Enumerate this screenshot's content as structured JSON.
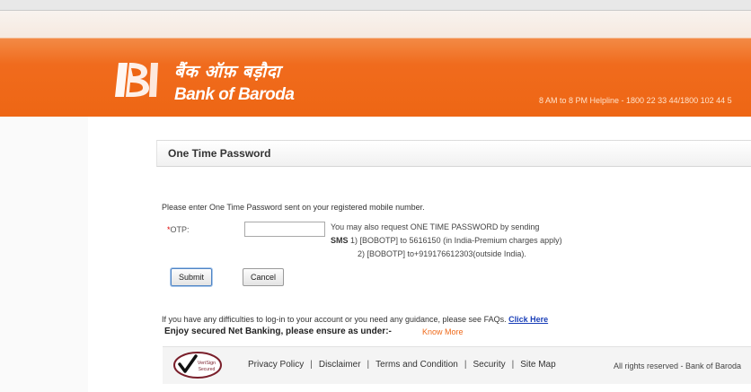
{
  "header": {
    "logo_hindi": "बैंक ऑफ़ बड़ौदा",
    "logo_english": "Bank of Baroda",
    "helpline": "8 AM to 8 PM Helpline - 1800 22 33 44/1800 102 44 5"
  },
  "otp_section": {
    "title": "One Time Password",
    "instruction": "Please enter One Time Password sent on your registered mobile number.",
    "otp_label_required": "*",
    "otp_label": "OTP:",
    "otp_value": "",
    "sms_line1": "You may also request ONE TIME PASSWORD by sending",
    "sms_prefix": "SMS",
    "sms_line2": " 1) [BOBOTP] to 5616150 (in India-Premium charges apply)",
    "sms_line3": "2) [BOBOTP] to+919176612303(outside India).",
    "submit_label": "Submit",
    "cancel_label": "Cancel"
  },
  "help": {
    "difficulty_text": "If you have any difficulties to log-in to your account or you need any guidance, please see FAQs. ",
    "click_here": "Click Here",
    "enjoy_text": "Enjoy secured Net Banking, please ensure as under:-",
    "know_more": "Know More"
  },
  "footer": {
    "links": [
      "Privacy Policy",
      "Disclaimer",
      "Terms and Condition",
      "Security",
      "Site Map"
    ],
    "separator": "|",
    "rights": "All rights reserved - Bank of Baroda",
    "badge_line1": "VeriSign",
    "badge_line2": "Secured"
  },
  "colors": {
    "brand_orange": "#ee6614",
    "link_blue": "#1a3fb8",
    "know_more_orange": "#ef6a1a"
  },
  "icons": {
    "logo": "bank-of-baroda-logo-icon",
    "badge": "verisign-secured-icon"
  }
}
